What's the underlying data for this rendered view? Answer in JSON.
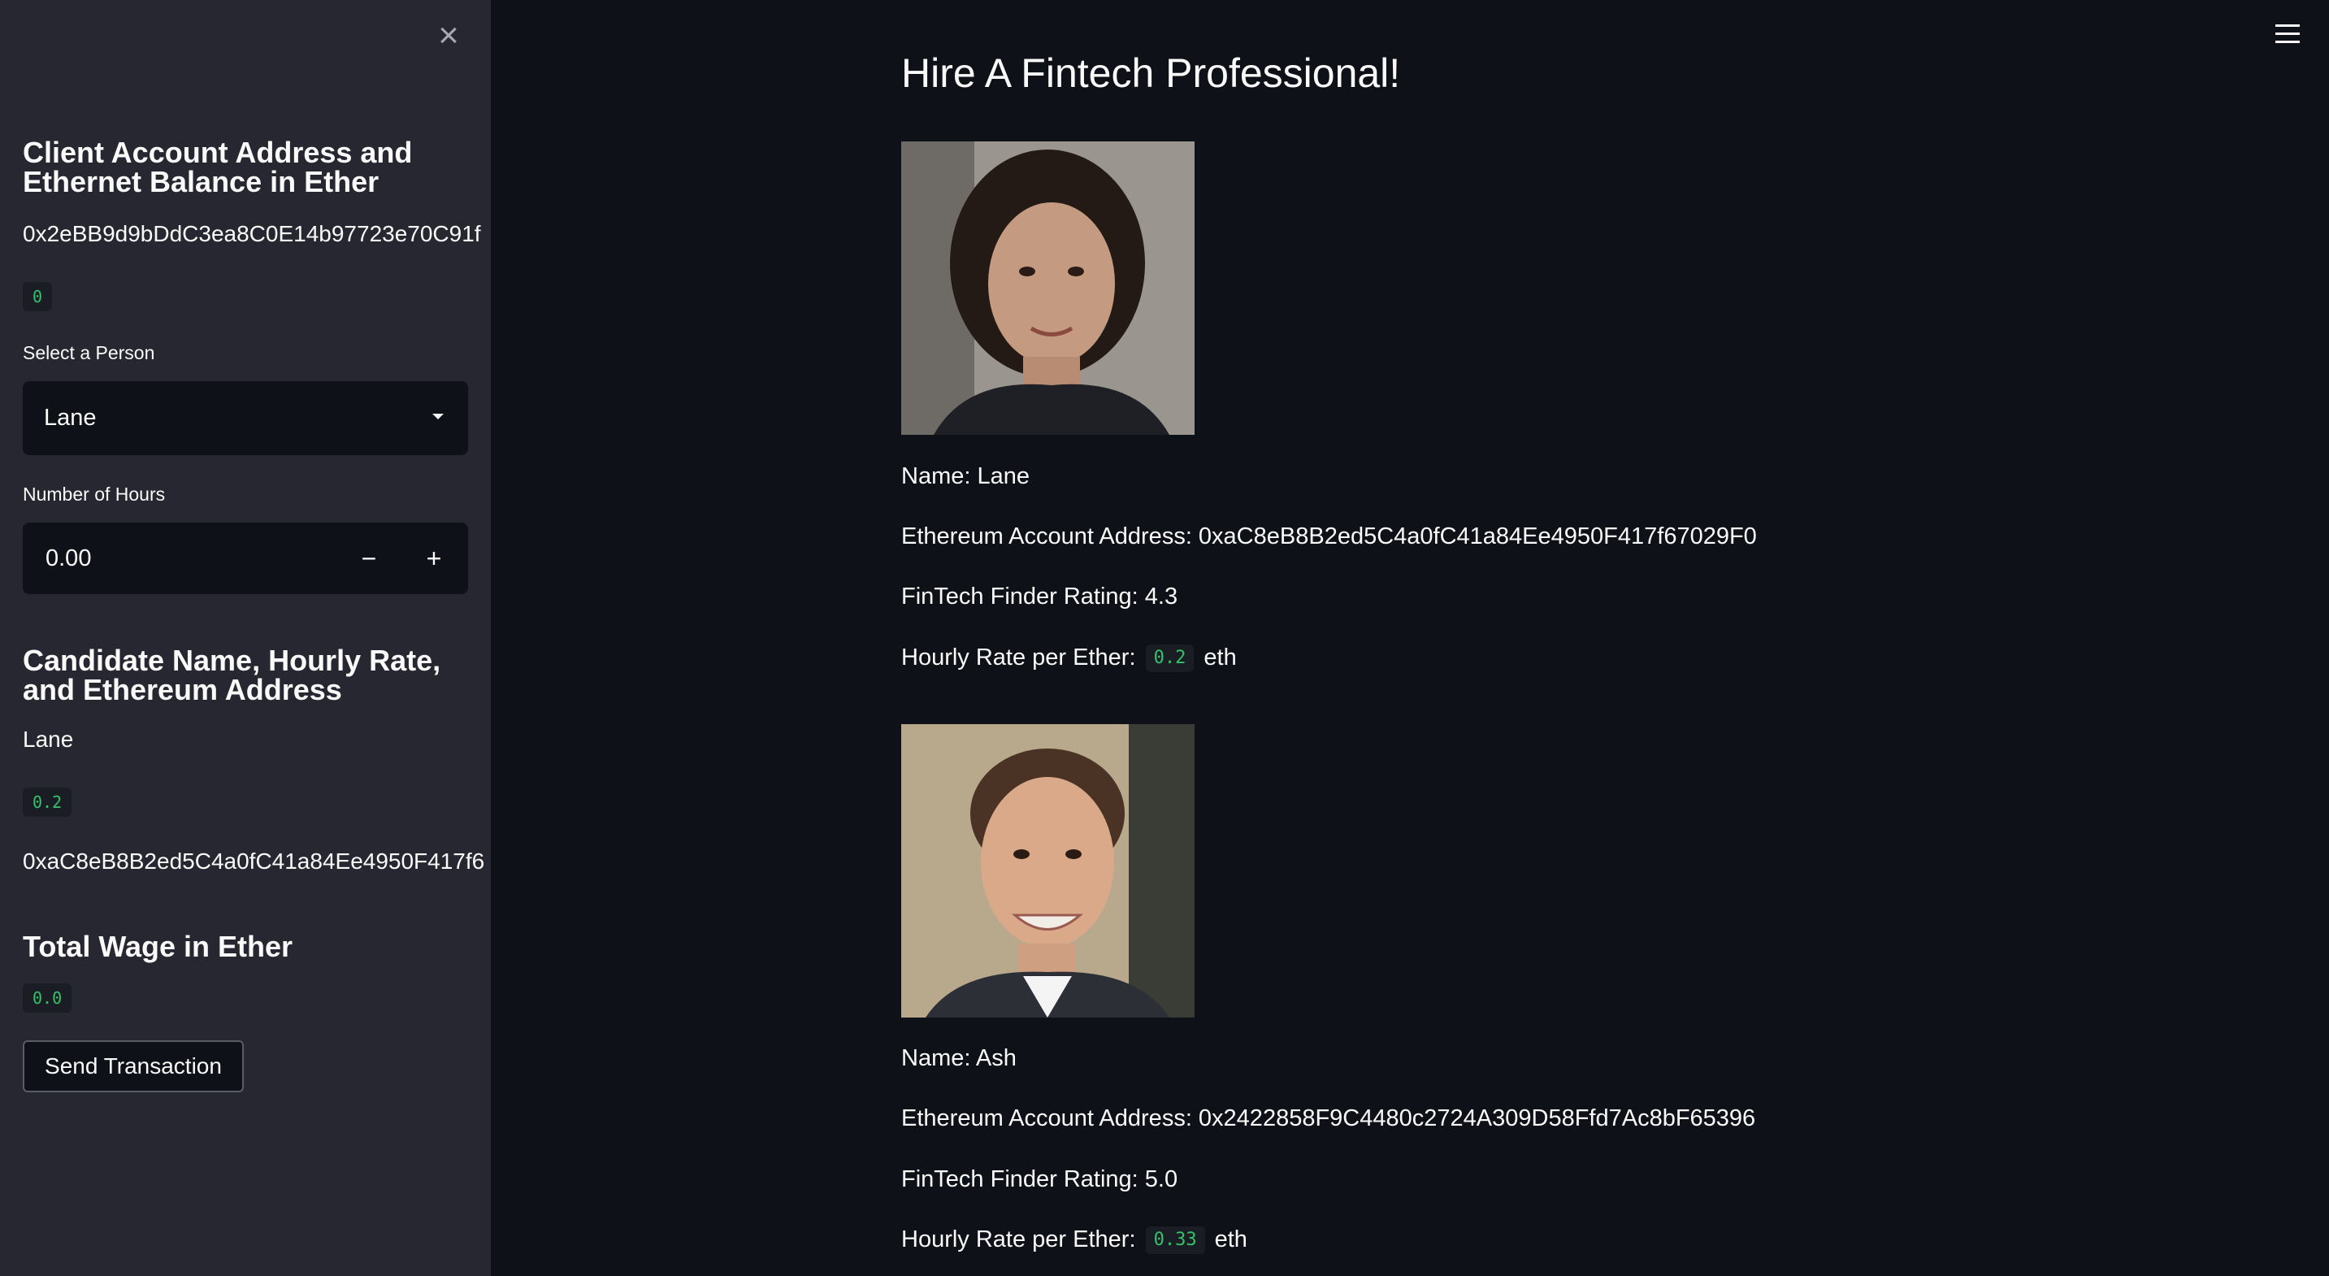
{
  "sidebar": {
    "client_heading": "Client Account Address and Ethernet Balance in Ether",
    "client_address": "0x2eBB9d9bDdC3ea8C0E14b97723e70C91f",
    "client_balance": "0",
    "select_label": "Select a Person",
    "select_value": "Lane",
    "hours_label": "Number of Hours",
    "hours_value": "0.00",
    "candidate_heading": "Candidate Name, Hourly Rate, and Ethereum Address",
    "candidate_name": "Lane",
    "candidate_rate": "0.2",
    "candidate_address": "0xaC8eB8B2ed5C4a0fC41a84Ee4950F417f6",
    "wage_heading": "Total Wage in Ether",
    "wage_value": "0.0",
    "send_label": "Send Transaction",
    "decrement": "−",
    "increment": "+",
    "close": "×"
  },
  "main": {
    "title": "Hire A Fintech Professional!",
    "candidates": [
      {
        "name_line": "Name: Lane",
        "address_line": "Ethereum Account Address: 0xaC8eB8B2ed5C4a0fC41a84Ee4950F417f67029F0",
        "rating_line": "FinTech Finder Rating: 4.3",
        "rate_prefix": "Hourly Rate per Ether:",
        "rate_value": "0.2",
        "rate_suffix": "eth"
      },
      {
        "name_line": "Name: Ash",
        "address_line": "Ethereum Account Address: 0x2422858F9C4480c2724A309D58Ffd7Ac8bF65396",
        "rating_line": "FinTech Finder Rating: 5.0",
        "rate_prefix": "Hourly Rate per Ether:",
        "rate_value": "0.33",
        "rate_suffix": "eth"
      }
    ]
  },
  "icons": {
    "close": "close-icon",
    "menu": "hamburger-menu-icon",
    "caret": "chevron-down-icon"
  },
  "colors": {
    "background": "#0e1117",
    "sidebar": "#262730",
    "code_text": "#33c26b",
    "code_bg": "#1b1d24"
  }
}
